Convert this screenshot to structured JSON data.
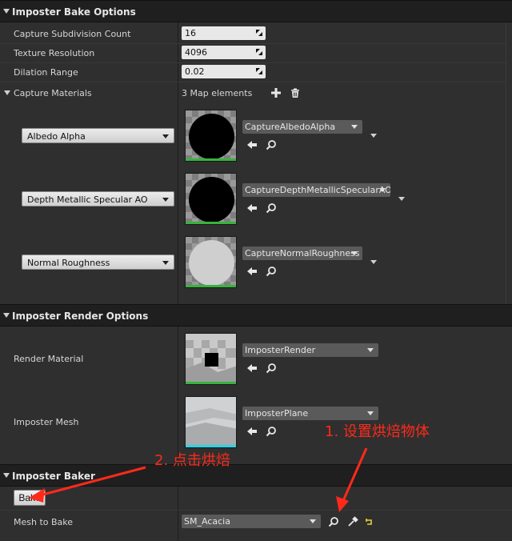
{
  "sections": {
    "bake_options": "Imposter Bake Options",
    "render_options": "Imposter Render Options",
    "baker": "Imposter Baker"
  },
  "bake_options": {
    "subdivision_label": "Capture Subdivision Count",
    "subdivision_value": "16",
    "texture_label": "Texture Resolution",
    "texture_value": "4096",
    "dilation_label": "Dilation Range",
    "dilation_value": "0.02",
    "materials_label": "Capture Materials",
    "materials_count": "3 Map elements",
    "entries": [
      {
        "key": "Albedo Alpha",
        "asset": "CaptureAlbedoAlpha"
      },
      {
        "key": "Depth Metallic Specular AO",
        "asset": "CaptureDepthMetallicSpecularAO"
      },
      {
        "key": "Normal Roughness",
        "asset": "CaptureNormalRoughness"
      }
    ]
  },
  "render_options": {
    "material_label": "Render Material",
    "material_asset": "ImposterRender",
    "mesh_label": "Imposter Mesh",
    "mesh_asset": "ImposterPlane"
  },
  "baker": {
    "bake_button": "Bake",
    "mesh_label": "Mesh to Bake",
    "mesh_value": "SM_Acacia"
  },
  "annotations": {
    "set_object": "1. 设置烘焙物体",
    "click_bake": "2. 点击烘焙",
    "color": "#ff2a1a"
  }
}
